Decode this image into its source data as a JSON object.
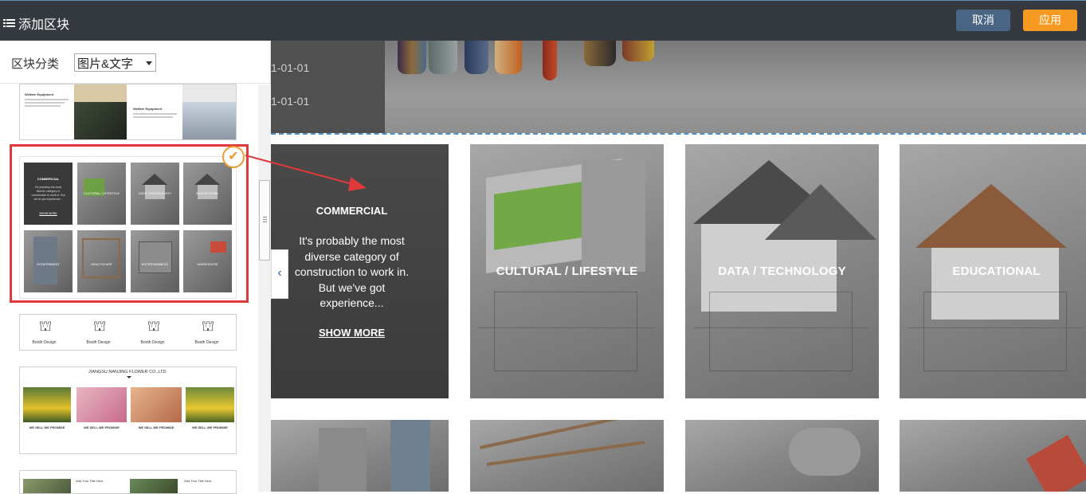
{
  "topbar": {
    "title": "添加区块",
    "title_icon": "list-icon",
    "cancel_label": "取消",
    "apply_label": "应用"
  },
  "sidebar": {
    "category_label": "区块分类",
    "category_selected": "图片&文字",
    "cards": [
      {
        "id": "card-1",
        "captions": [
          "Welfare Equipment",
          "Welfare Equipment"
        ]
      },
      {
        "id": "card-2-selected",
        "selected": true,
        "tiles": [
          "COMMERCIAL",
          "CULTURAL / LIFESTYLE",
          "DATA / TECHNOLOGY",
          "EDUCATIONAL",
          "GOVERNMENT",
          "HEALTHCARE",
          "ENTERTAINMENT",
          "WAREHOUSE"
        ],
        "commercial_text": "It's probably the most diverse category of construction to work in. But we've got experience...",
        "show_more": "SHOW MORE"
      },
      {
        "id": "card-3",
        "items": [
          "Booth Design",
          "Booth Design",
          "Booth Design",
          "Booth Design"
        ]
      },
      {
        "id": "card-4",
        "title": "JIANGSU NANJING FLOWER CO.,LTD.",
        "headings": [
          "WE SELL WE PROMISE",
          "WE SELL WE PROMISE",
          "WE SELL WE PROMISE",
          "WE SELL WE PROMISE"
        ]
      },
      {
        "id": "card-5",
        "headings": [
          "Add Your Title Here",
          "Add Your Title Here"
        ]
      }
    ]
  },
  "canvas": {
    "hero_dates": [
      "1-01-01",
      "1-01-01"
    ],
    "tiles": [
      {
        "label": "COMMERCIAL",
        "desc": "It's probably the most diverse category of construction to work in. But we've got experience...",
        "link": "SHOW MORE"
      },
      {
        "label": "CULTURAL / LIFESTYLE"
      },
      {
        "label": "DATA / TECHNOLOGY"
      },
      {
        "label": "EDUCATIONAL"
      }
    ],
    "prev_arrow": "‹"
  },
  "colors": {
    "topbar_bg": "#353a40",
    "cancel_bg": "#4a6584",
    "apply_bg": "#f69a22",
    "selection_border": "#e0393c",
    "check_badge": "#f29a2e",
    "dashed_line": "#4a8fc9"
  }
}
